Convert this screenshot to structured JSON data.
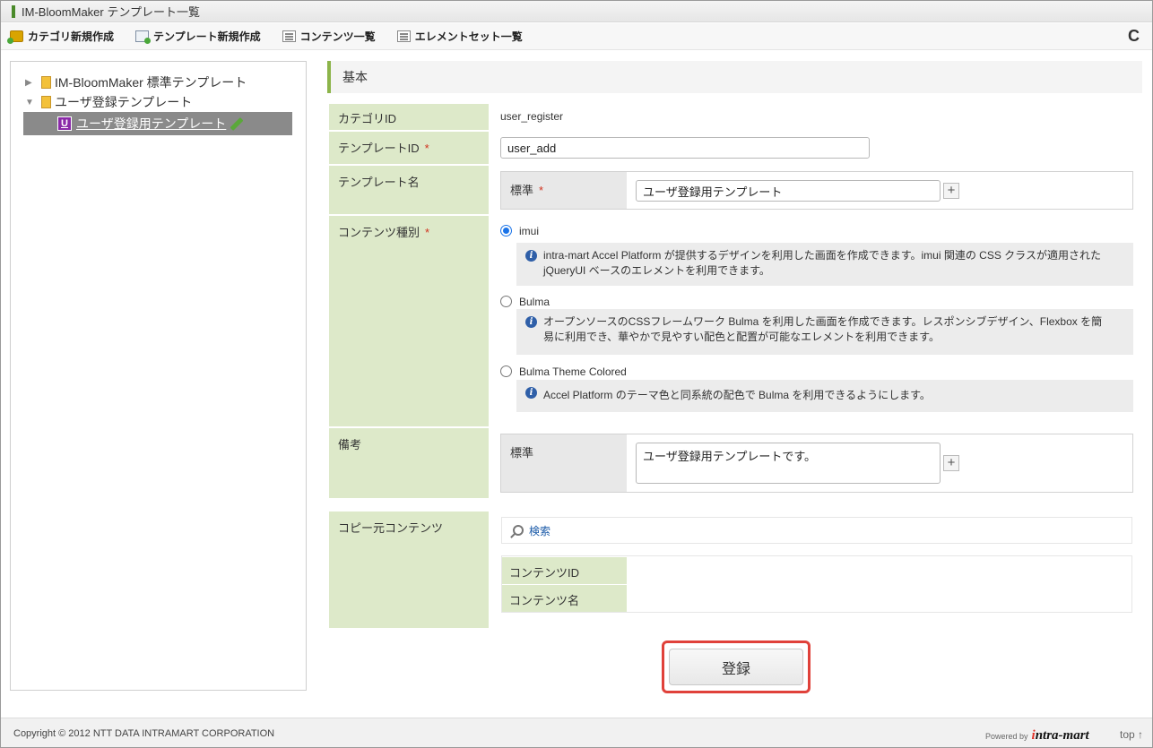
{
  "window": {
    "title": "IM-BloomMaker テンプレート一覧"
  },
  "toolbar": {
    "new_category": "カテゴリ新規作成",
    "new_template": "テンプレート新規作成",
    "content_list": "コンテンツ一覧",
    "element_set_list": "エレメントセット一覧",
    "refresh": "C"
  },
  "tree": {
    "nodes": [
      {
        "label": "IM-BloomMaker 標準テンプレート",
        "arrow": "▶"
      },
      {
        "label": "ユーザ登録テンプレート",
        "arrow": "▼"
      }
    ],
    "selected": {
      "badge": "U",
      "label": "ユーザ登録用テンプレート"
    }
  },
  "section": {
    "title": "基本"
  },
  "form": {
    "category_id": {
      "label": "カテゴリID",
      "value": "user_register"
    },
    "template_id": {
      "label": "テンプレートID",
      "required": "*",
      "value": "user_add"
    },
    "template_name": {
      "label": "テンプレート名",
      "lang_label": "標準",
      "required": "*",
      "value": "ユーザ登録用テンプレート",
      "plus": "+"
    },
    "content_type": {
      "label": "コンテンツ種別",
      "required": "*",
      "options": [
        {
          "label": "imui",
          "info_line1": "intra-mart Accel Platform が提供するデザインを利用した画面を作成できます。imui 関連の CSS クラスが適用された",
          "info_line2": "jQueryUI ベースのエレメントを利用できます。"
        },
        {
          "label": "Bulma",
          "info_line1": "オープンソースのCSSフレームワーク Bulma を利用した画面を作成できます。レスポンシブデザイン、Flexbox を簡",
          "info_line2": "易に利用でき、華やかで見やすい配色と配置が可能なエレメントを利用できます。"
        },
        {
          "label": "Bulma Theme Colored",
          "info_line1": "Accel Platform のテーマ色と同系統の配色で Bulma を利用できるようにします。"
        }
      ],
      "info_icon": "i"
    },
    "remarks": {
      "label": "備考",
      "lang_label": "標準",
      "value": "ユーザ登録用テンプレートです。",
      "plus": "+"
    },
    "copy_source": {
      "label": "コピー元コンテンツ",
      "search_label": "検索",
      "content_id_label": "コンテンツID",
      "content_name_label": "コンテンツ名"
    }
  },
  "submit": {
    "label": "登録"
  },
  "footer": {
    "copyright": "Copyright © 2012 NTT DATA INTRAMART CORPORATION",
    "powered_by": "Powered by",
    "brand_i": "i",
    "brand_rest": "ntra-mart",
    "top_link": "top ↑"
  },
  "colors": {
    "label_bg": "#dde9c9",
    "accent_green": "#8cb44a",
    "highlight_red": "#e0413a",
    "radio_blue": "#1a73e8"
  }
}
